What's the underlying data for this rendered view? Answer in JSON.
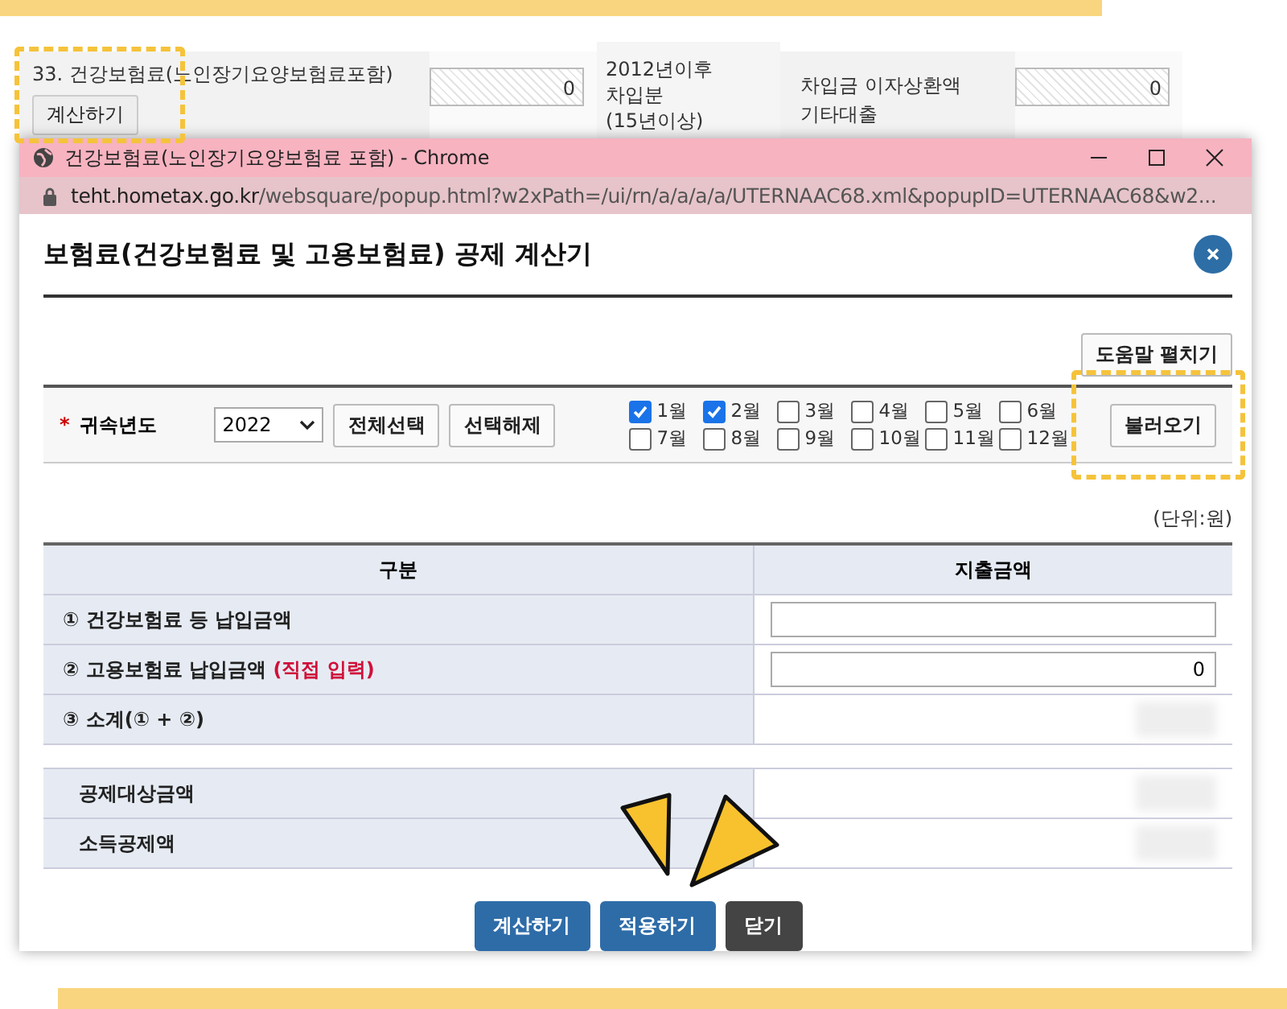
{
  "background_page": {
    "row_label": "33. 건강보험료(노인장기요양보험료포함)",
    "row_button": "계산하기",
    "field_1_value": "0",
    "period_lines": [
      "2012년이후",
      "차입분",
      "(15년이상)"
    ],
    "loan_lines": [
      "차입금 이자상환액",
      "기타대출"
    ],
    "field_2_value": "0"
  },
  "window": {
    "title": "건강보험료(노인장기요양보험료 포함) - Chrome",
    "url_host": "teht.hometax.go.kr",
    "url_path": "/websquare/popup.html?w2xPath=/ui/rn/a/a/a/a/UTERNAAC68.xml&popupID=UTERNAAC68&w2..."
  },
  "dialog": {
    "title": "보험료(건강보험료 및 고용보험료) 공제 계산기",
    "help_button": "도움말 펼치기",
    "filter": {
      "required_mark": "*",
      "label": "귀속년도",
      "year": "2022",
      "select_all": "전체선택",
      "clear_all": "선택해제",
      "load_button": "불러오기",
      "months": [
        {
          "label": "1월",
          "checked": true
        },
        {
          "label": "2월",
          "checked": true
        },
        {
          "label": "3월",
          "checked": false
        },
        {
          "label": "4월",
          "checked": false
        },
        {
          "label": "5월",
          "checked": false
        },
        {
          "label": "6월",
          "checked": false
        },
        {
          "label": "7월",
          "checked": false
        },
        {
          "label": "8월",
          "checked": false
        },
        {
          "label": "9월",
          "checked": false
        },
        {
          "label": "10월",
          "checked": false
        },
        {
          "label": "11월",
          "checked": false
        },
        {
          "label": "12월",
          "checked": false
        }
      ]
    },
    "unit": "(단위:원)",
    "table": {
      "columns": [
        "구분",
        "지출금액"
      ],
      "rows": [
        {
          "label": "① 건강보험료 등 납입금액",
          "kind": "input",
          "value": ""
        },
        {
          "label": "② 고용보험료 납입금액 **(직접 입력)**",
          "kind": "input",
          "value": "0"
        },
        {
          "label": "③ 소계(① + ②)",
          "kind": "text",
          "value": ""
        }
      ]
    },
    "summary_rows": [
      {
        "label": "공제대상금액"
      },
      {
        "label": "소득공제액"
      }
    ],
    "buttons": [
      {
        "label": "계산하기",
        "kind": "primary"
      },
      {
        "label": "적용하기",
        "kind": "primary"
      },
      {
        "label": "닫기",
        "kind": "dark"
      }
    ]
  }
}
